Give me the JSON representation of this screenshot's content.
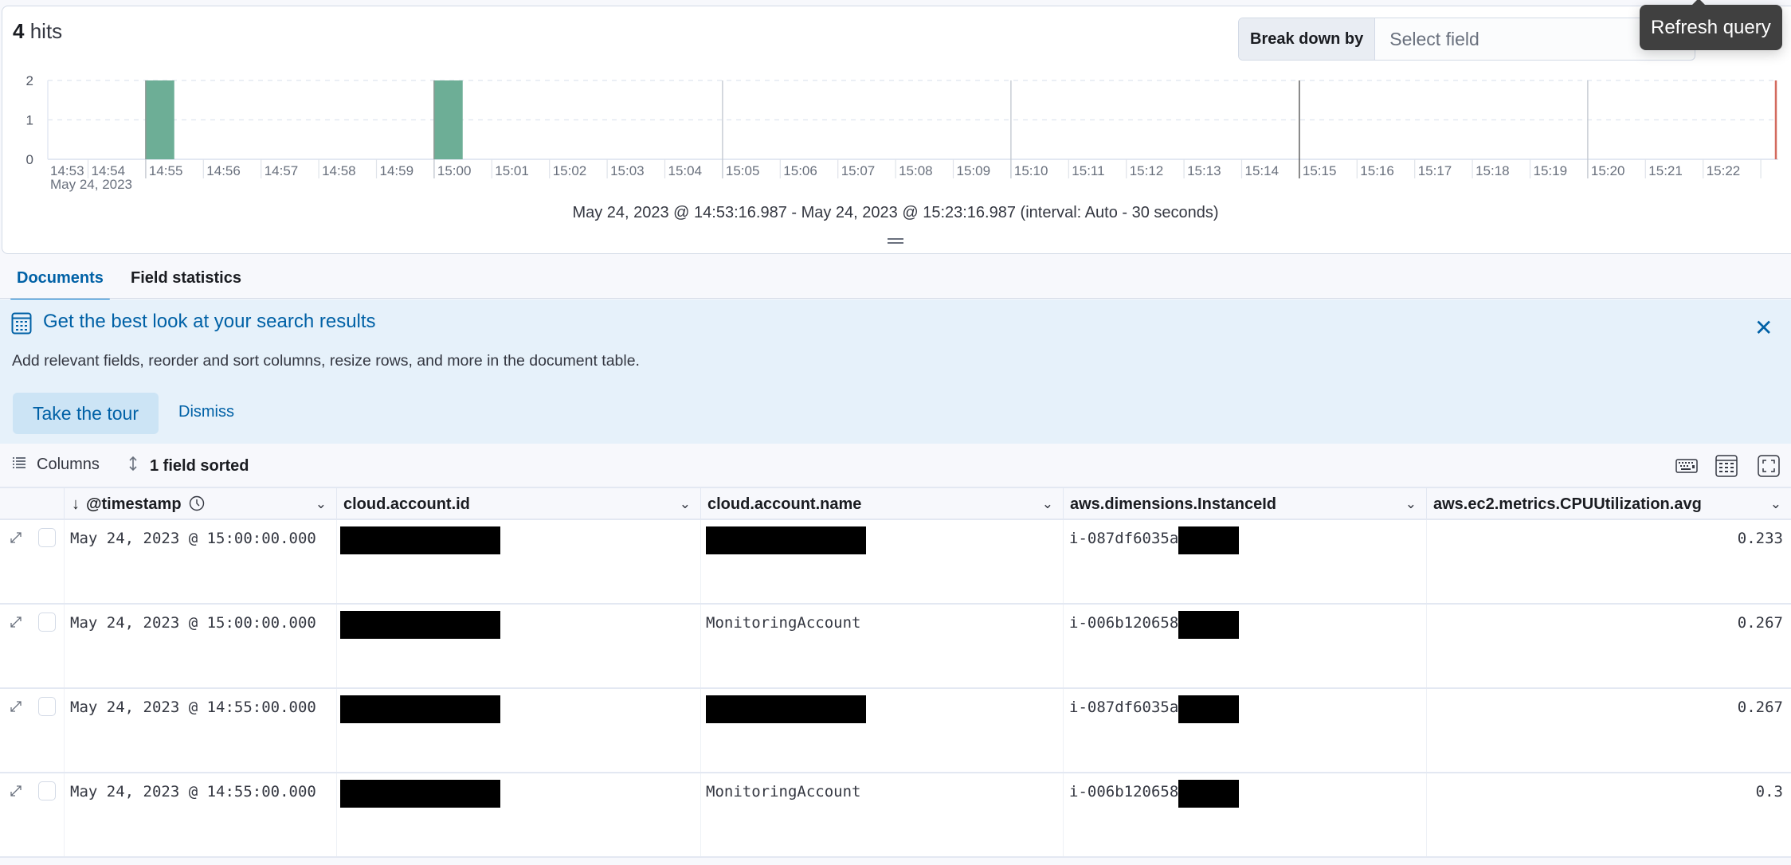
{
  "header": {
    "hits_count": "4",
    "hits_label": "hits",
    "breakdown_label": "Break down by",
    "breakdown_placeholder": "Select field",
    "tooltip": "Refresh query"
  },
  "chart_data": {
    "type": "bar",
    "title": "",
    "xlabel": "",
    "ylabel": "",
    "ylim": [
      0,
      2
    ],
    "yticks": [
      "0",
      "1",
      "2"
    ],
    "grid": true,
    "x_ticks": [
      "14:53",
      "14:54",
      "14:55",
      "14:56",
      "14:57",
      "14:58",
      "14:59",
      "15:00",
      "15:01",
      "15:02",
      "15:03",
      "15:04",
      "15:05",
      "15:06",
      "15:07",
      "15:08",
      "15:09",
      "15:10",
      "15:11",
      "15:12",
      "15:13",
      "15:14",
      "15:15",
      "15:16",
      "15:17",
      "15:18",
      "15:19",
      "15:20",
      "15:21",
      "15:22"
    ],
    "x_subtitle": "May 24, 2023",
    "bar_interval_seconds": 30,
    "bars": [
      {
        "start": "14:55:00",
        "value": 2
      },
      {
        "start": "15:00:00",
        "value": 2
      }
    ],
    "bar_color": "#6dae96",
    "now_marker_color": "#d36a5e",
    "range_start": "14:53:16.987",
    "range_end": "15:23:16.987",
    "range_text": "May 24, 2023 @ 14:53:16.987 - May 24, 2023 @ 15:23:16.987 (interval: Auto - 30 seconds)"
  },
  "tabs": [
    {
      "label": "Documents",
      "active": true
    },
    {
      "label": "Field statistics",
      "active": false
    }
  ],
  "callout": {
    "title": "Get the best look at your search results",
    "description": "Add relevant fields, reorder and sort columns, resize rows, and more in the document table.",
    "tour_button": "Take the tour",
    "dismiss_button": "Dismiss"
  },
  "toolbar": {
    "columns_label": "Columns",
    "sort_label": "1 field sorted"
  },
  "table": {
    "columns": [
      {
        "label": "@timestamp",
        "sorted": "desc"
      },
      {
        "label": "cloud.account.id"
      },
      {
        "label": "cloud.account.name"
      },
      {
        "label": "aws.dimensions.InstanceId"
      },
      {
        "label": "aws.ec2.metrics.CPUUtilization.avg"
      }
    ],
    "rows": [
      {
        "timestamp": "May 24, 2023 @ 15:00:00.000",
        "account_id": "[redacted]",
        "account_name": "[redacted]",
        "instance_id": "i-087df6035a",
        "cpu": "0.233"
      },
      {
        "timestamp": "May 24, 2023 @ 15:00:00.000",
        "account_id": "[redacted]",
        "account_name": "MonitoringAccount",
        "instance_id": "i-006b120658",
        "cpu": "0.267"
      },
      {
        "timestamp": "May 24, 2023 @ 14:55:00.000",
        "account_id": "[redacted]",
        "account_name": "[redacted]",
        "instance_id": "i-087df6035a",
        "cpu": "0.267"
      },
      {
        "timestamp": "May 24, 2023 @ 14:55:00.000",
        "account_id": "[redacted]",
        "account_name": "MonitoringAccount",
        "instance_id": "i-006b120658",
        "cpu": "0.3"
      }
    ]
  }
}
